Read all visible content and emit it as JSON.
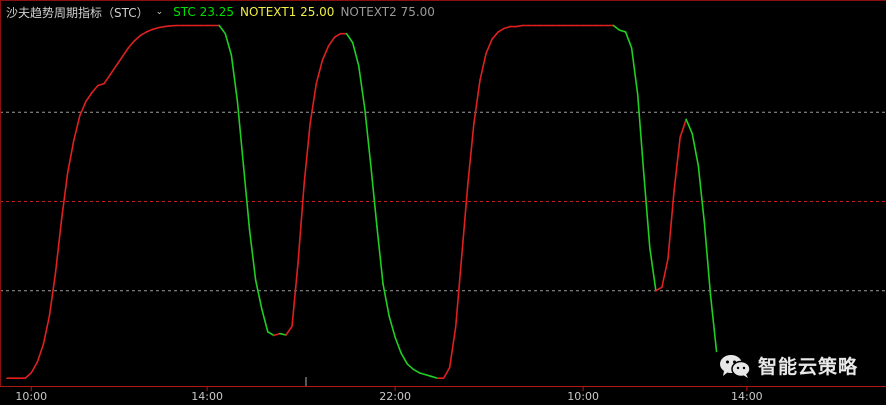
{
  "legend": {
    "indicator_name": "沙夫趋势周期指标（STC）",
    "stc": "STC 23.25",
    "notext1": "NOTEXT1 25.00",
    "notext2": "NOTEXT2 75.00"
  },
  "watermark": {
    "text": "智能云策略",
    "icon": "wechat-icon"
  },
  "colors": {
    "up": "#e02020",
    "down": "#20d020",
    "grid_line": "#9c9c9c",
    "ref_line": "#c82020",
    "axis_text": "#c8c8c8"
  },
  "chart_data": {
    "type": "line",
    "ylim": [
      0,
      100
    ],
    "xlim": [
      0,
      140
    ],
    "reference_lines": [
      25,
      50,
      75
    ],
    "xtick_labels": [
      {
        "x": 4,
        "label": "10:00"
      },
      {
        "x": 33,
        "label": "14:00"
      },
      {
        "x": 64,
        "label": "22:00"
      },
      {
        "x": 95,
        "label": "10:00"
      },
      {
        "x": 122,
        "label": "14:00"
      }
    ],
    "series": [
      {
        "values": [
          0.5,
          0.5,
          0.5,
          0.5,
          2,
          5,
          10,
          18,
          30,
          45,
          58,
          67,
          74,
          78,
          80.5,
          82.5,
          83,
          85.5,
          88,
          90.5,
          93,
          95,
          96.5,
          97.5,
          98.2,
          98.7,
          99,
          99.2,
          99.3,
          99.3,
          99.3,
          99.3,
          99.3,
          99.3,
          99.3,
          99.3,
          97,
          91,
          78,
          60,
          42,
          28,
          20,
          13.5,
          12.5,
          13,
          12.6,
          15,
          33,
          55,
          72,
          83,
          89.5,
          93.5,
          96,
          97,
          97,
          94.5,
          88,
          76,
          60,
          43,
          27,
          18,
          12,
          7.5,
          4.5,
          3,
          2,
          1.5,
          1,
          0.5,
          0.5,
          3.5,
          15,
          35,
          55,
          72,
          84,
          91.5,
          95.5,
          97.5,
          98.5,
          99,
          99,
          99.3,
          99.3,
          99.3,
          99.3,
          99.3,
          99.3,
          99.3,
          99.3,
          99.3,
          99.3,
          99.3,
          99.3,
          99.3,
          99.3,
          99.3,
          99.3,
          98,
          97.5,
          93,
          80,
          58,
          37,
          25,
          26,
          34,
          53,
          68,
          73,
          69,
          60,
          44,
          24,
          8
        ],
        "direction": "auto"
      }
    ]
  }
}
